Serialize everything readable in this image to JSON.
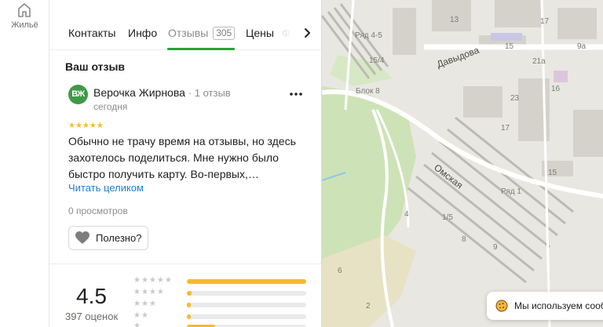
{
  "rail": {
    "housing_label": "Жильё",
    "housing_icon": "house-icon"
  },
  "tabs": {
    "items": [
      {
        "label": "Контакты"
      },
      {
        "label": "Инфо"
      },
      {
        "label": "Отзывы",
        "count": "305",
        "active": true
      },
      {
        "label": "Цены"
      },
      {
        "label": "Ф"
      }
    ],
    "next_icon": "chevron-right-icon",
    "accent_color": "#2e9e3b"
  },
  "review": {
    "section_title": "Ваш отзыв",
    "avatar_initials": "ВЖ",
    "avatar_color": "#3e9a48",
    "author": "Верочка Жирнова",
    "author_meta": "· 1 отзыв",
    "date": "сегодня",
    "rating_stars": 5,
    "text": "Обычно не трачу время на отзывы, но здесь захотелось поделиться. Мне нужно было быстро получить карту. Во-первых,…",
    "read_more": "Читать целиком",
    "views": "0 просмотров",
    "useful_label": "Полезно?",
    "more_icon": "more-dots-icon"
  },
  "summary": {
    "rating": "4.5",
    "count_label": "397 оценок",
    "distribution": [
      {
        "stars": 5,
        "fraction": 1.0
      },
      {
        "stars": 4,
        "fraction": 0.04
      },
      {
        "stars": 3,
        "fraction": 0.03
      },
      {
        "stars": 2,
        "fraction": 0.03
      },
      {
        "stars": 1,
        "fraction": 0.24
      }
    ],
    "bar_color": "#f8b92b"
  },
  "map": {
    "streets": [
      "Давыдова",
      "Омская"
    ],
    "labels": [
      "Ряд 4-5",
      "15/4",
      "Блок 8",
      "Ряд 1",
      "17",
      "15",
      "13",
      "9а",
      "21а",
      "16",
      "23",
      "15",
      "17",
      "4",
      "1/5",
      "6",
      "2",
      "8",
      "9"
    ]
  },
  "cookie": {
    "text": "Мы используем сообщ",
    "icon": "cookie-icon"
  }
}
